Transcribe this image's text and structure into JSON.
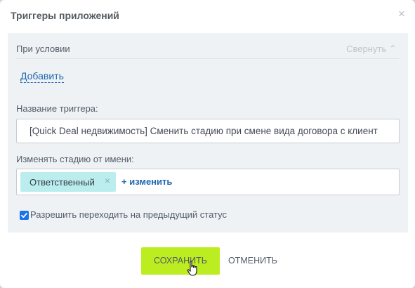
{
  "dialog": {
    "title": "Триггеры приложений",
    "close_glyph": "×"
  },
  "condition": {
    "label": "При условии",
    "collapse_label": "Свернуть",
    "collapse_icon": "chevron-up-icon",
    "add_label": "Добавить"
  },
  "trigger_name": {
    "label": "Название триггера:",
    "value": "[Quick Deal недвижимость] Сменить стадию при смене вида договора с клиент"
  },
  "change_stage_as": {
    "label": "Изменять стадию от имени:",
    "chip_label": "Ответственный",
    "chip_remove_glyph": "×",
    "change_link_label": "+ изменить"
  },
  "allow_previous": {
    "checked": true,
    "label": "Разрешить переходить на предыдущий статус"
  },
  "buttons": {
    "save_label": "СОХРАНИТЬ",
    "cancel_label": "ОТМЕНИТЬ"
  },
  "colors": {
    "save_button": "#bbed21",
    "link": "#2067b0",
    "chip": "#bcedee",
    "panel_bg": "#eef2f4",
    "checkbox": "#1a73e8"
  }
}
